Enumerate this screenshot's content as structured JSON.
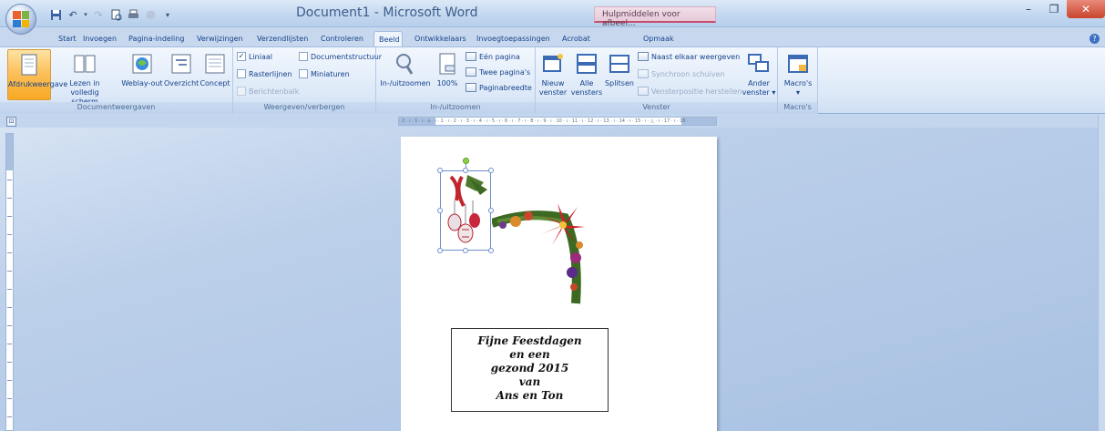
{
  "title_bar": {
    "title": "Document1 - Microsoft Word",
    "contextual_tab_title": "Hulpmiddelen voor afbeel...",
    "minimize": "–",
    "maximize": "❐",
    "close": "✕"
  },
  "quick_access": {
    "save": "💾",
    "undo": "↶",
    "redo": "↷",
    "print_preview": "🖶",
    "more": "▾"
  },
  "tabs": [
    "Start",
    "Invoegen",
    "Pagina-indeling",
    "Verwijzingen",
    "Verzendlijsten",
    "Controleren",
    "Beeld",
    "Ontwikkelaars",
    "Invoegtoepassingen",
    "Acrobat",
    "Opmaak"
  ],
  "active_tab": "Beeld",
  "help": "?",
  "ribbon": {
    "documentweergaven": {
      "label": "Documentweergaven",
      "afdrukweergave": "Afdrukweergave",
      "lezen_line1": "Lezen in",
      "lezen_line2": "volledig scherm",
      "weblay_out": "Weblay-out",
      "overzicht": "Overzicht",
      "concept": "Concept"
    },
    "weergeven": {
      "label": "Weergeven/verbergen",
      "liniaal": "Liniaal",
      "rasterlijnen": "Rasterlijnen",
      "berichtenbalk": "Berichtenbalk",
      "documentstructuur": "Documentstructuur",
      "miniaturen": "Miniaturen",
      "check_mark": "✓"
    },
    "zoom": {
      "label": "In-/uitzoomen",
      "in_uitzoomen": "In-/uitzoomen",
      "hundred": "100%",
      "een_pagina": "Eén pagina",
      "twee_paginas": "Twee pagina's",
      "paginabreedte": "Paginabreedte"
    },
    "venster": {
      "label": "Venster",
      "nieuw_1": "Nieuw",
      "nieuw_2": "venster",
      "alle_1": "Alle",
      "alle_2": "vensters",
      "splitsen": "Splitsen",
      "naast_elkaar": "Naast elkaar weergeven",
      "synchroon": "Synchroon schuiven",
      "vensterpositie": "Vensterpositie herstellen",
      "ander_1": "Ander",
      "ander_2": "venster ▾"
    },
    "macros": {
      "label": "Macro's",
      "macros_btn": "Macro's",
      "arrow": "▾"
    }
  },
  "ruler": {
    "toggle": "⊡",
    "numbers": "· 2 · ı · 1 · ı · ⌂ · ı · 1 · ı · 2 · ı · 3 · ı · 4 · ı · 5 · ı · 6 · ı · 7 · ı · 8 · ı · 9 · ı · 10 · ı · 11 · ı · 12 · ı · 13 · ı · 14 · ı · 15 · ı · △ · ı · 17 · ı · 18 ·"
  },
  "document": {
    "greeting_lines": [
      "Fijne Feestdagen",
      "en een",
      "gezond 2015",
      "van",
      "Ans en Ton"
    ]
  },
  "colors": {
    "ribbon_blue": "#dde9f8",
    "selected_orange": "#fbc15c",
    "context_pink": "#c94a6c"
  }
}
